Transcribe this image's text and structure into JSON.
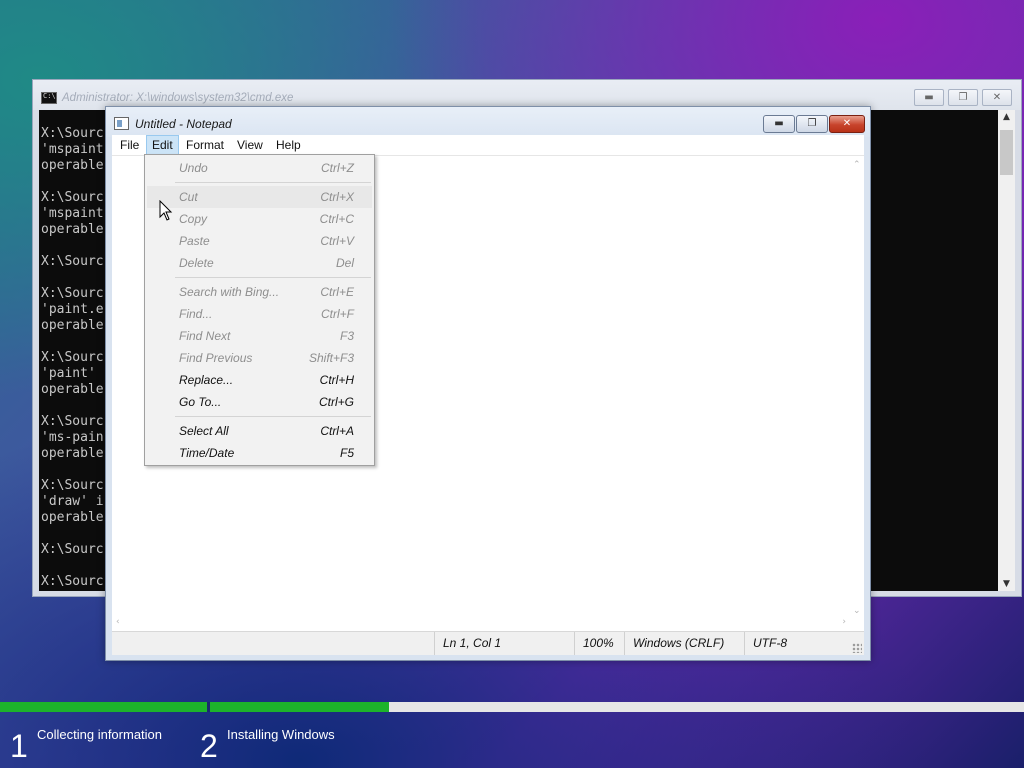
{
  "cmd": {
    "title": "Administrator: X:\\windows\\system32\\cmd.exe",
    "lines": "X:\\Sourc\n'mspaint\noperable\n\nX:\\Sourc\n'mspaint\noperable\n\nX:\\Sourc\n\nX:\\Sourc\n'paint.e\noperable\n\nX:\\Sourc\n'paint' \noperable\n\nX:\\Sourc\n'ms-pain\noperable\n\nX:\\Sourc\n'draw' i\noperable\n\nX:\\Sourc\n\nX:\\Sourc",
    "minimize_icon": "minimize-icon",
    "maximize_icon": "maximize-icon",
    "close_icon": "close-icon"
  },
  "notepad": {
    "title": "Untitled - Notepad",
    "menu": [
      "File",
      "Edit",
      "Format",
      "View",
      "Help"
    ],
    "active_menu": "Edit",
    "status": {
      "position": "Ln 1, Col 1",
      "zoom": "100%",
      "line_ending": "Windows (CRLF)",
      "encoding": "UTF-8"
    }
  },
  "edit_menu": {
    "items": [
      {
        "label": "Undo",
        "shortcut": "Ctrl+Z",
        "enabled": false
      },
      {
        "label": "Cut",
        "shortcut": "Ctrl+X",
        "enabled": false
      },
      {
        "label": "Copy",
        "shortcut": "Ctrl+C",
        "enabled": false
      },
      {
        "label": "Paste",
        "shortcut": "Ctrl+V",
        "enabled": false
      },
      {
        "label": "Delete",
        "shortcut": "Del",
        "enabled": false
      },
      {
        "label": "Search with Bing...",
        "shortcut": "Ctrl+E",
        "enabled": false
      },
      {
        "label": "Find...",
        "shortcut": "Ctrl+F",
        "enabled": false
      },
      {
        "label": "Find Next",
        "shortcut": "F3",
        "enabled": false
      },
      {
        "label": "Find Previous",
        "shortcut": "Shift+F3",
        "enabled": false
      },
      {
        "label": "Replace...",
        "shortcut": "Ctrl+H",
        "enabled": true
      },
      {
        "label": "Go To...",
        "shortcut": "Ctrl+G",
        "enabled": true
      },
      {
        "label": "Select All",
        "shortcut": "Ctrl+A",
        "enabled": true
      },
      {
        "label": "Time/Date",
        "shortcut": "F5",
        "enabled": true
      }
    ]
  },
  "setup": {
    "steps": [
      {
        "number": "1",
        "label": "Collecting information",
        "progress": 1.0
      },
      {
        "number": "2",
        "label": "Installing Windows",
        "progress": 0.22
      }
    ],
    "progress_color": "#1db32b"
  }
}
